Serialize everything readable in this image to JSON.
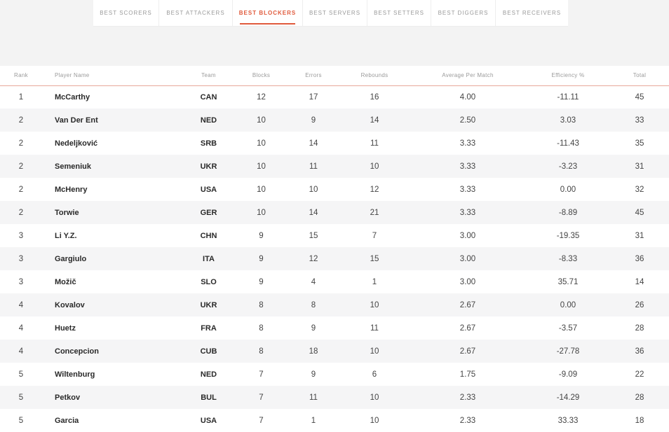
{
  "tabs": [
    {
      "label": "BEST SCORERS",
      "active": false
    },
    {
      "label": "BEST ATTACKERS",
      "active": false
    },
    {
      "label": "BEST BLOCKERS",
      "active": true
    },
    {
      "label": "BEST SERVERS",
      "active": false
    },
    {
      "label": "BEST SETTERS",
      "active": false
    },
    {
      "label": "BEST DIGGERS",
      "active": false
    },
    {
      "label": "BEST RECEIVERS",
      "active": false
    }
  ],
  "colors": {
    "accent": "#e05a3c",
    "stripe": "#f5f5f6",
    "background": "#f3f3f3"
  },
  "table": {
    "headers": {
      "rank": "Rank",
      "name": "Player Name",
      "team": "Team",
      "blocks": "Blocks",
      "errors": "Errors",
      "rebounds": "Rebounds",
      "avg": "Average Per Match",
      "eff": "Efficiency %",
      "total": "Total"
    },
    "rows": [
      {
        "rank": "1",
        "name": "McCarthy",
        "team": "CAN",
        "blocks": "12",
        "errors": "17",
        "rebounds": "16",
        "avg": "4.00",
        "eff": "-11.11",
        "total": "45"
      },
      {
        "rank": "2",
        "name": "Van Der Ent",
        "team": "NED",
        "blocks": "10",
        "errors": "9",
        "rebounds": "14",
        "avg": "2.50",
        "eff": "3.03",
        "total": "33"
      },
      {
        "rank": "2",
        "name": "Nedeljković",
        "team": "SRB",
        "blocks": "10",
        "errors": "14",
        "rebounds": "11",
        "avg": "3.33",
        "eff": "-11.43",
        "total": "35"
      },
      {
        "rank": "2",
        "name": "Semeniuk",
        "team": "UKR",
        "blocks": "10",
        "errors": "11",
        "rebounds": "10",
        "avg": "3.33",
        "eff": "-3.23",
        "total": "31"
      },
      {
        "rank": "2",
        "name": "McHenry",
        "team": "USA",
        "blocks": "10",
        "errors": "10",
        "rebounds": "12",
        "avg": "3.33",
        "eff": "0.00",
        "total": "32"
      },
      {
        "rank": "2",
        "name": "Torwie",
        "team": "GER",
        "blocks": "10",
        "errors": "14",
        "rebounds": "21",
        "avg": "3.33",
        "eff": "-8.89",
        "total": "45"
      },
      {
        "rank": "3",
        "name": "Li Y.Z.",
        "team": "CHN",
        "blocks": "9",
        "errors": "15",
        "rebounds": "7",
        "avg": "3.00",
        "eff": "-19.35",
        "total": "31"
      },
      {
        "rank": "3",
        "name": "Gargiulo",
        "team": "ITA",
        "blocks": "9",
        "errors": "12",
        "rebounds": "15",
        "avg": "3.00",
        "eff": "-8.33",
        "total": "36"
      },
      {
        "rank": "3",
        "name": "Možič",
        "team": "SLO",
        "blocks": "9",
        "errors": "4",
        "rebounds": "1",
        "avg": "3.00",
        "eff": "35.71",
        "total": "14"
      },
      {
        "rank": "4",
        "name": "Kovalov",
        "team": "UKR",
        "blocks": "8",
        "errors": "8",
        "rebounds": "10",
        "avg": "2.67",
        "eff": "0.00",
        "total": "26"
      },
      {
        "rank": "4",
        "name": "Huetz",
        "team": "FRA",
        "blocks": "8",
        "errors": "9",
        "rebounds": "11",
        "avg": "2.67",
        "eff": "-3.57",
        "total": "28"
      },
      {
        "rank": "4",
        "name": "Concepcion",
        "team": "CUB",
        "blocks": "8",
        "errors": "18",
        "rebounds": "10",
        "avg": "2.67",
        "eff": "-27.78",
        "total": "36"
      },
      {
        "rank": "5",
        "name": "Wiltenburg",
        "team": "NED",
        "blocks": "7",
        "errors": "9",
        "rebounds": "6",
        "avg": "1.75",
        "eff": "-9.09",
        "total": "22"
      },
      {
        "rank": "5",
        "name": "Petkov",
        "team": "BUL",
        "blocks": "7",
        "errors": "11",
        "rebounds": "10",
        "avg": "2.33",
        "eff": "-14.29",
        "total": "28"
      },
      {
        "rank": "5",
        "name": "Garcia",
        "team": "USA",
        "blocks": "7",
        "errors": "1",
        "rebounds": "10",
        "avg": "2.33",
        "eff": "33.33",
        "total": "18"
      }
    ]
  }
}
